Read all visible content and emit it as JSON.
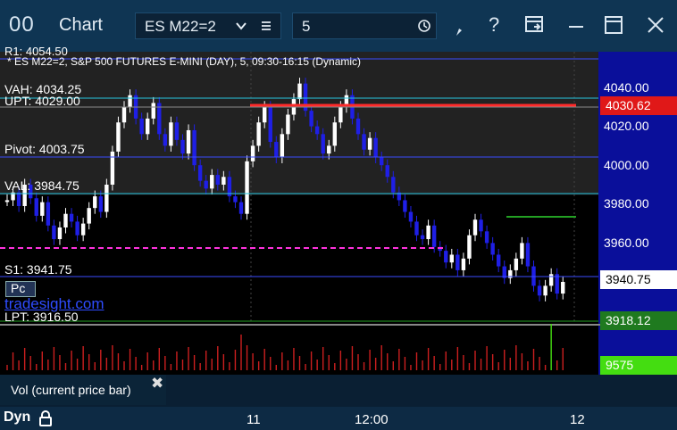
{
  "window": {
    "title": "Chart",
    "logo": "00"
  },
  "toolbar": {
    "instrument": "ES M22=2",
    "interval": "5",
    "icons": [
      "chevron-down-icon",
      "menu-icon",
      "clock-icon",
      "draw-tool-icon",
      "help-icon",
      "template-icon",
      "minimize-icon",
      "maximize-icon",
      "close-icon"
    ]
  },
  "chart": {
    "header": "* ES M22=2, S&P 500 FUTURES E-MINI (DAY), 5, 09:30-16:15 (Dynamic)",
    "top_label": "R1: 4054.50",
    "levels": {
      "vah": "VAH: 4034.25",
      "upt": "UPT: 4029.00",
      "pivot": "Pivot: 4003.75",
      "val": "VAL: 3984.75",
      "s1": "S1: 3941.75",
      "lpt": "LPT: 3916.50",
      "pc": "Pc",
      "watermark": "tradesight.com"
    },
    "price_axis": [
      "4040.00",
      "4020.00",
      "4000.00",
      "3980.00",
      "3960.00"
    ],
    "price_boxes": {
      "upt": "4030.62",
      "last": "3940.75",
      "lpt": "3918.12",
      "volume": "9575"
    },
    "colors": {
      "up": "#ffffff",
      "down": "#1f1fe6",
      "upt_line": "#ff2a2a",
      "pc_line": "#ff33dd",
      "lpt_line": "#23a023",
      "vol": "#cc1f1f"
    }
  },
  "volume_panel": {
    "label": "Vol (current price bar)"
  },
  "footer": {
    "mode": "Dyn",
    "time_labels": [
      "11",
      "12:00",
      "12"
    ]
  }
}
